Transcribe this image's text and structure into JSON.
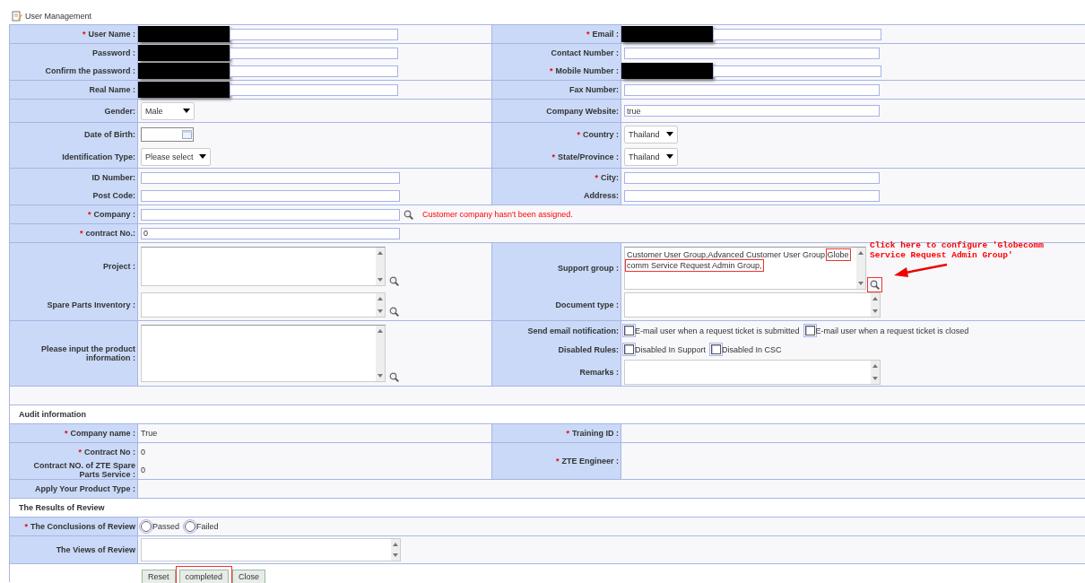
{
  "header": {
    "title": "User Management"
  },
  "sections": [
    {
      "kind": "pair",
      "left": [
        {
          "required_mark": "*",
          "label": "User Name :",
          "control": {
            "kind": "text",
            "redacted": true
          }
        }
      ],
      "right": [
        {
          "required_mark": "*",
          "label": "Email :",
          "control": {
            "kind": "text",
            "redacted": true
          }
        }
      ]
    },
    {
      "kind": "pair",
      "left": [
        {
          "label": "Password :",
          "control": {
            "kind": "text",
            "redacted": true
          }
        },
        {
          "label": "Confirm the password :",
          "control": {
            "kind": "text",
            "redacted": true
          }
        }
      ],
      "right": [
        {
          "label": "Contact Number :",
          "control": {
            "kind": "text"
          }
        },
        {
          "required_mark": "*",
          "label": "Mobile Number :",
          "control": {
            "kind": "text",
            "redacted": true
          }
        }
      ]
    },
    {
      "kind": "pair",
      "left": [
        {
          "label": "Real Name :",
          "control": {
            "kind": "text",
            "redacted": true
          }
        }
      ],
      "right": [
        {
          "label": "Fax Number:",
          "control": {
            "kind": "text"
          }
        }
      ]
    },
    {
      "kind": "pair",
      "left": [
        {
          "label": "Gender:",
          "control": {
            "kind": "select",
            "value": "Male"
          }
        }
      ],
      "right": [
        {
          "label": "Company Website:",
          "control": {
            "kind": "text",
            "value": "true"
          }
        }
      ]
    },
    {
      "kind": "pair",
      "left": [
        {
          "label": "Date of Birth:",
          "control": {
            "kind": "date"
          }
        },
        {
          "label": "Identification Type:",
          "control": {
            "kind": "select",
            "value": "Please select"
          }
        }
      ],
      "right": [
        {
          "required_mark": "*",
          "label": "Country :",
          "control": {
            "kind": "select",
            "value": "Thailand"
          }
        },
        {
          "required_mark": "*",
          "label": "State/Province :",
          "control": {
            "kind": "select",
            "value": "Thailand"
          }
        }
      ]
    },
    {
      "kind": "pair",
      "left": [
        {
          "label": "ID Number:",
          "control": {
            "kind": "text"
          }
        },
        {
          "label": "Post Code:",
          "control": {
            "kind": "text"
          }
        }
      ],
      "right": [
        {
          "required_mark": "*",
          "label": "City:",
          "control": {
            "kind": "text"
          }
        },
        {
          "label": "Address:",
          "control": {
            "kind": "text"
          }
        }
      ]
    },
    {
      "kind": "wide",
      "left": [
        {
          "required_mark": "*",
          "label": "Company :",
          "control": {
            "kind": "text",
            "search": true,
            "error": "Customer company hasn't been assigned."
          }
        }
      ]
    },
    {
      "kind": "wide",
      "left": [
        {
          "required_mark": "*",
          "label": "contract No.:",
          "control": {
            "kind": "text",
            "value": "0"
          }
        }
      ]
    },
    {
      "kind": "pair",
      "left": [
        {
          "label": "Project :",
          "control": {
            "kind": "memo",
            "search": true
          }
        },
        {
          "label": "Spare Parts Inventory :",
          "control": {
            "kind": "box",
            "search": true
          }
        }
      ],
      "right": [
        {
          "label": "Support group :",
          "control": {
            "kind": "memo",
            "parts": [
              {
                "text": "Customer User Group,Advanced Customer User Group,"
              },
              {
                "text": "Globecomm Service Request Admin Group,",
                "highlighted": true
              }
            ],
            "search": {
              "highlighted": true
            }
          }
        },
        {
          "label": "Document type :",
          "control": {
            "kind": "box"
          }
        }
      ]
    },
    {
      "kind": "pair",
      "left": [
        {
          "label": "Please input the product information :",
          "control": {
            "kind": "memo",
            "search": true
          }
        }
      ],
      "right": [
        {
          "label": "Send email notification:",
          "control": {
            "kind": "checks",
            "options": [
              {
                "label": "E-mail user when a request ticket is submitted",
                "checked": false
              },
              {
                "label": "E-mail user when a request ticket is closed",
                "checked": false
              }
            ]
          }
        },
        {
          "label": "Disabled Rules:",
          "control": {
            "kind": "checks",
            "options": [
              {
                "label": "Disabled In Support",
                "checked": false
              },
              {
                "label": "Disabled In CSC",
                "checked": false
              }
            ]
          }
        },
        {
          "label": "Remarks :",
          "control": {
            "kind": "box"
          }
        }
      ]
    },
    {
      "kind": "blank"
    },
    {
      "kind": "heading",
      "title": "Audit information"
    },
    {
      "kind": "pair",
      "left": [
        {
          "required_mark": "*",
          "label": "Company name :",
          "control": {
            "kind": "static",
            "value": "True"
          }
        }
      ],
      "right": [
        {
          "required_mark": "*",
          "label": "Training ID :",
          "control": {
            "kind": "static"
          }
        }
      ]
    },
    {
      "kind": "pair",
      "left": [
        {
          "required_mark": "*",
          "label": "Contract No :",
          "control": {
            "kind": "static",
            "value": "0"
          }
        },
        {
          "label": "Contract NO. of ZTE Spare Parts Service :",
          "control": {
            "kind": "static",
            "value": "0"
          }
        }
      ],
      "right": [
        {
          "required_mark": "*",
          "label": "ZTE Engineer :",
          "control": {
            "kind": "static"
          }
        }
      ]
    },
    {
      "kind": "wide",
      "left": [
        {
          "label": "Apply Your Product Type :",
          "control": {
            "kind": "static"
          }
        }
      ]
    },
    {
      "kind": "heading",
      "title": "The Results of Review"
    },
    {
      "kind": "wide",
      "left": [
        {
          "required_mark": "*",
          "label": "The Conclusions of Review",
          "control": {
            "kind": "radios",
            "options": [
              {
                "label": "Passed",
                "selected": false
              },
              {
                "label": "Failed",
                "selected": false
              }
            ]
          }
        }
      ]
    },
    {
      "kind": "wide",
      "left": [
        {
          "label": "The Views of Review",
          "control": {
            "kind": "box"
          }
        }
      ]
    },
    {
      "kind": "buttons",
      "buttons": [
        {
          "label": "Reset",
          "highlighted": false
        },
        {
          "label": "completed",
          "highlighted": true
        },
        {
          "label": "Close",
          "highlighted": false
        }
      ]
    }
  ],
  "annotation": {
    "text": "Click here to configure 'Globecomm Service Request Admin Group'"
  }
}
